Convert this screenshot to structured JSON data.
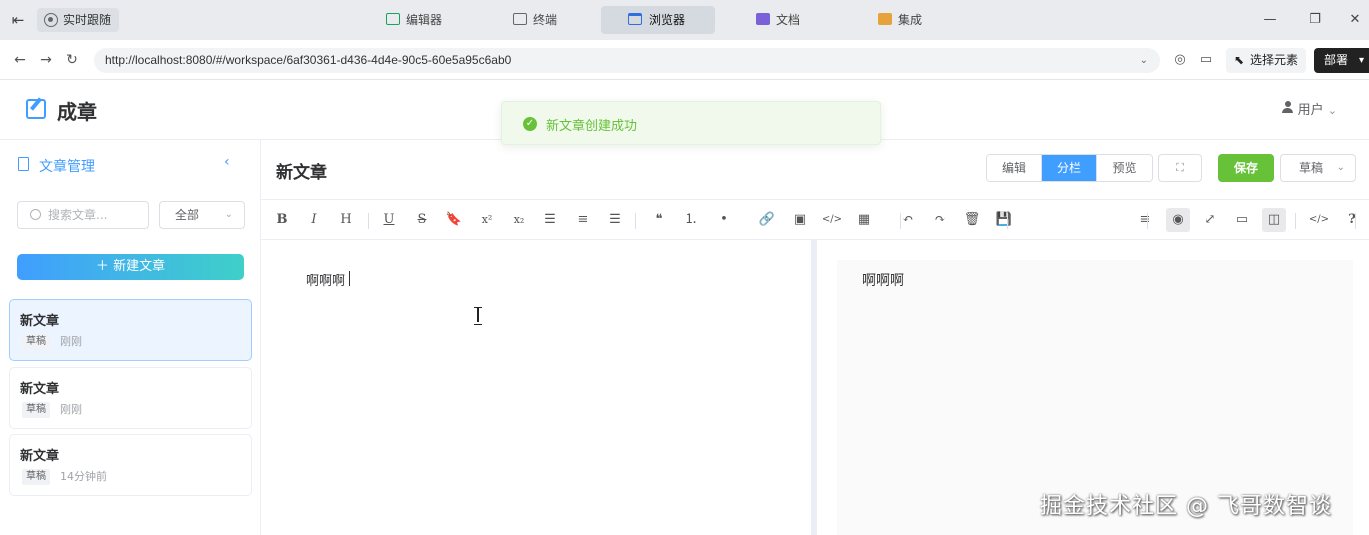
{
  "window": {
    "live_label": "实时跟随",
    "tabs": [
      {
        "label": "编辑器",
        "icon": "code-editor-icon",
        "color": "#1aa260"
      },
      {
        "label": "终端",
        "icon": "terminal-icon",
        "color": "#666666"
      },
      {
        "label": "浏览器",
        "icon": "browser-icon",
        "color": "#2f6fe0"
      },
      {
        "label": "文档",
        "icon": "book-icon",
        "color": "#7b61d9"
      },
      {
        "label": "集成",
        "icon": "integration-icon",
        "color": "#e6a23c"
      }
    ],
    "controls": {
      "minimize": "—",
      "maximize": "❐",
      "close": "✕"
    }
  },
  "address": {
    "url": "http://localhost:8080/#/workspace/6af30361-d436-4d4e-90c5-60e5a95c6ab0",
    "select_element": "选择元素",
    "deploy": "部署"
  },
  "app": {
    "name": "成章",
    "user": "用户"
  },
  "toast": {
    "message": "新文章创建成功",
    "color": "#67c23a"
  },
  "sidebar": {
    "title": "文章管理",
    "search_placeholder": "搜索文章...",
    "filter": "全部",
    "new_button": "新建文章",
    "articles": [
      {
        "title": "新文章",
        "status": "草稿",
        "time": "刚刚"
      },
      {
        "title": "新文章",
        "status": "草稿",
        "time": "刚刚"
      },
      {
        "title": "新文章",
        "status": "草稿",
        "time": "14分钟前"
      }
    ]
  },
  "editor": {
    "title": "新文章",
    "modes": [
      "编辑",
      "分栏",
      "预览"
    ],
    "active_mode": "分栏",
    "fullscreen_glyph": "⛶",
    "save": "保存",
    "status": "草稿",
    "content": "啊啊啊",
    "preview": "啊啊啊"
  },
  "toolbar": {
    "left": [
      {
        "name": "bold-icon",
        "glyph": "B"
      },
      {
        "name": "italic-icon",
        "glyph": "I"
      },
      {
        "name": "heading-icon",
        "glyph": "H"
      },
      {
        "name": "underline-icon",
        "glyph": "U"
      },
      {
        "name": "strikethrough-icon",
        "glyph": "S"
      },
      {
        "name": "bookmark-icon",
        "glyph": "🔖"
      },
      {
        "name": "superscript-icon",
        "glyph": "x²"
      },
      {
        "name": "subscript-icon",
        "glyph": "x₂"
      },
      {
        "name": "align-left-icon",
        "glyph": "☰"
      },
      {
        "name": "align-center-icon",
        "glyph": "≡"
      },
      {
        "name": "align-right-icon",
        "glyph": "☰"
      },
      {
        "name": "quote-icon",
        "glyph": "❝"
      },
      {
        "name": "ordered-list-icon",
        "glyph": "⒈"
      },
      {
        "name": "unordered-list-icon",
        "glyph": "•"
      },
      {
        "name": "link-icon",
        "glyph": "🔗"
      },
      {
        "name": "image-icon",
        "glyph": "▣"
      },
      {
        "name": "code-icon",
        "glyph": "</>"
      },
      {
        "name": "table-icon",
        "glyph": "▦"
      },
      {
        "name": "undo-icon",
        "glyph": "↶"
      },
      {
        "name": "redo-icon",
        "glyph": "↷"
      },
      {
        "name": "trash-icon",
        "glyph": "🗑"
      },
      {
        "name": "save-icon",
        "glyph": "💾"
      }
    ],
    "right": [
      {
        "name": "menu-icon",
        "glyph": "≡"
      },
      {
        "name": "eye-off-icon",
        "glyph": "◉"
      },
      {
        "name": "fullscreen-icon",
        "glyph": "⤢"
      },
      {
        "name": "window-icon",
        "glyph": "▭"
      },
      {
        "name": "split-view-icon",
        "glyph": "◫"
      },
      {
        "name": "source-code-icon",
        "glyph": "</>"
      },
      {
        "name": "help-icon",
        "glyph": "?"
      }
    ]
  },
  "watermark": "掘金技术社区 @ 飞哥数智谈"
}
